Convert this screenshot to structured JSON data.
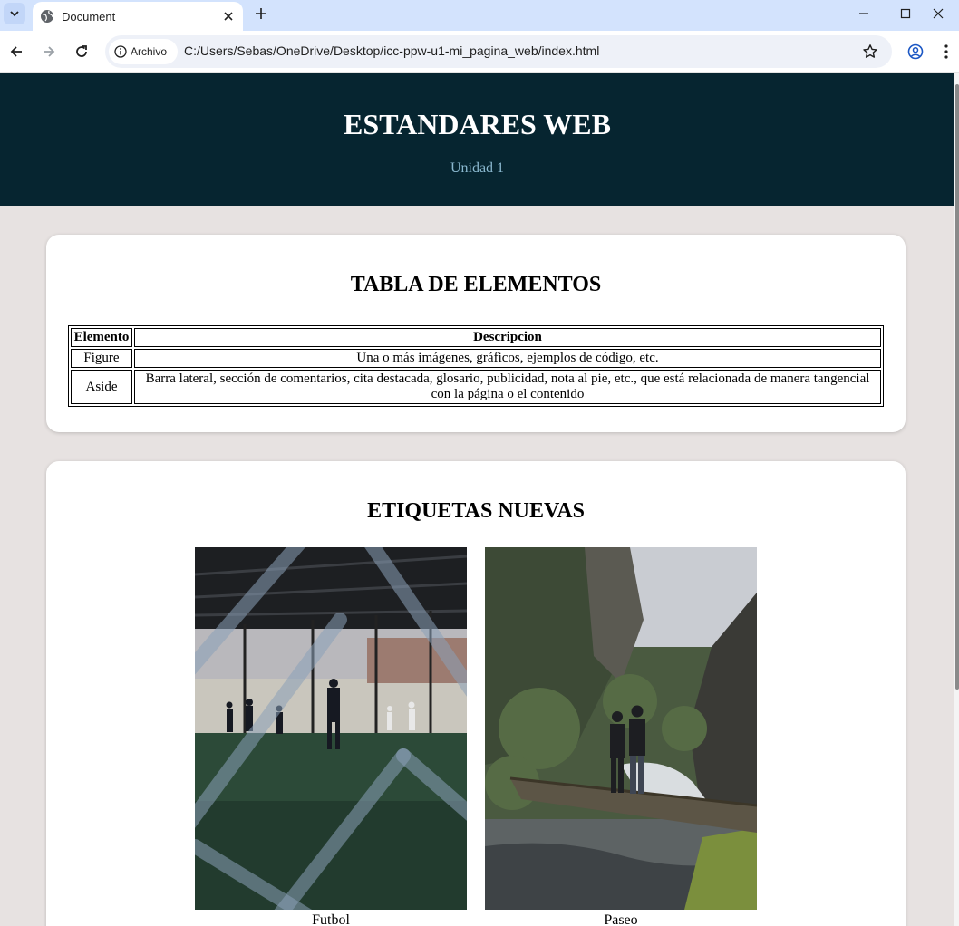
{
  "browser": {
    "tab_title": "Document",
    "chip_label": "Archivo",
    "url": "C:/Users/Sebas/OneDrive/Desktop/icc-ppw-u1-mi_pagina_web/index.html"
  },
  "header": {
    "title": "ESTANDARES WEB",
    "subtitle": "Unidad 1"
  },
  "table_section": {
    "title": "TABLA DE ELEMENTOS",
    "columns": [
      "Elemento",
      "Descripcion"
    ],
    "rows": [
      [
        "Figure",
        "Una o más imágenes, gráficos, ejemplos de código, etc."
      ],
      [
        "Aside",
        "Barra lateral, sección de comentarios, cita destacada, glosario, publicidad, nota al pie, etc., que está relacionada de manera tangencial con la página o el contenido"
      ]
    ]
  },
  "tags_section": {
    "title": "ETIQUETAS NUEVAS",
    "figures": [
      {
        "caption": "Futbol"
      },
      {
        "caption": "Paseo"
      }
    ]
  },
  "colors": {
    "header_bg": "#062530",
    "subtitle": "#8ab8cf",
    "page_bg": "#e7e2e1",
    "tabbar_bg": "#d3e3fd"
  }
}
